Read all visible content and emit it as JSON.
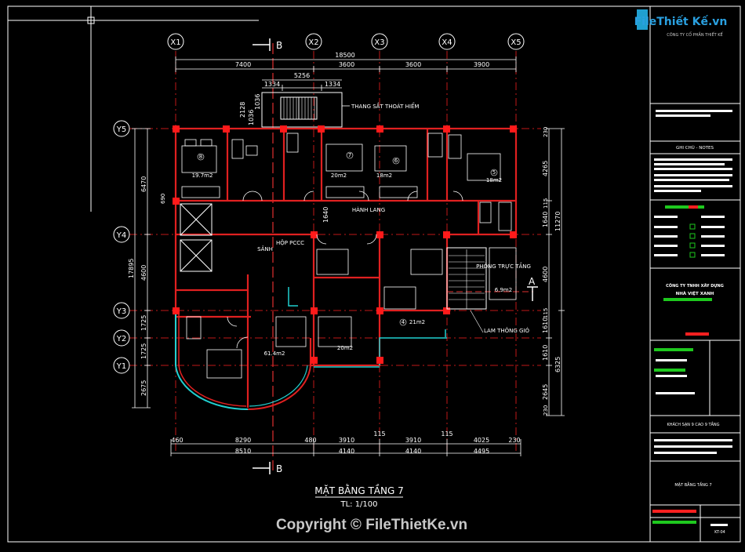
{
  "watermark": {
    "logo_text": "FileThiết Kế.vn",
    "copyright": "Copyright © FileThietKe.vn"
  },
  "drawing": {
    "title": "MẶT BẰNG TẦNG 7",
    "scale": "TL: 1/100",
    "axes_x": [
      "X1",
      "X2",
      "X3",
      "X4",
      "X5"
    ],
    "axes_y": [
      "Y5",
      "Y4",
      "Y3",
      "Y2",
      "Y1"
    ],
    "section_b": "B",
    "section_a": "A",
    "top_total": "18500",
    "top_dims": [
      "7400",
      "3600",
      "3600",
      "3900"
    ],
    "stair_dims": [
      "5256",
      "1334",
      "1334"
    ],
    "stair_label": "THANG SẮT THOÁT HIỂM",
    "bottom_dims": [
      "8290",
      "3910",
      "3910",
      "4025"
    ],
    "bottom_small": [
      "460",
      "480",
      "115",
      "115",
      "230"
    ],
    "bottom_totals": [
      "8510",
      "4140",
      "4140",
      "4495"
    ],
    "left_dims": [
      "6470",
      "17895",
      "4600",
      "1725",
      "1725",
      "2675"
    ],
    "left_small": [
      "690"
    ],
    "right_dims": [
      "4265",
      "1640",
      "4600",
      "1610",
      "1610",
      "2645"
    ],
    "right_totals": [
      "11270",
      "6325"
    ],
    "right_small": [
      "230",
      "115",
      "115",
      "230"
    ],
    "stair_vert_dims": [
      "2128",
      "1036",
      "1036"
    ],
    "rooms": {
      "r8": "8",
      "r8_area": "19.7m2",
      "r7": "7",
      "r7_area": "20m2",
      "r6": "6",
      "r6_area": "18m2",
      "r5": "5",
      "r5_area": "18m2",
      "r4": "4",
      "r4_area": "21m2",
      "r3_area": "20m2",
      "big_area": "61.4m2",
      "corridor": "HÀNH LANG",
      "lobby": "SẢNH",
      "fire_box": "HỘP PCCC",
      "shaft": "PHÒNG TRỰC TẦNG",
      "shaft_area": "6.9m2",
      "vent": "LAM THÔNG GIÓ",
      "dim_1640": "1640"
    }
  },
  "title_block": {
    "top_label": "CÔNG TY CỔ PHẦN THIẾT KẾ",
    "notes_label": "GHI CHÚ - NOTES",
    "company": "CÔNG TY TNHH XÂY DỰNG",
    "company_sub": "NHÀ VIỆT XANH",
    "project": "KHÁCH SẠN 9 CAO 9 TẦNG",
    "sheet_title": "MẶT BẰNG TẦNG 7",
    "sheet_no": "KT-04",
    "colors": {
      "red": "#ff2020",
      "green": "#1ec81e",
      "white": "#ffffff"
    }
  }
}
